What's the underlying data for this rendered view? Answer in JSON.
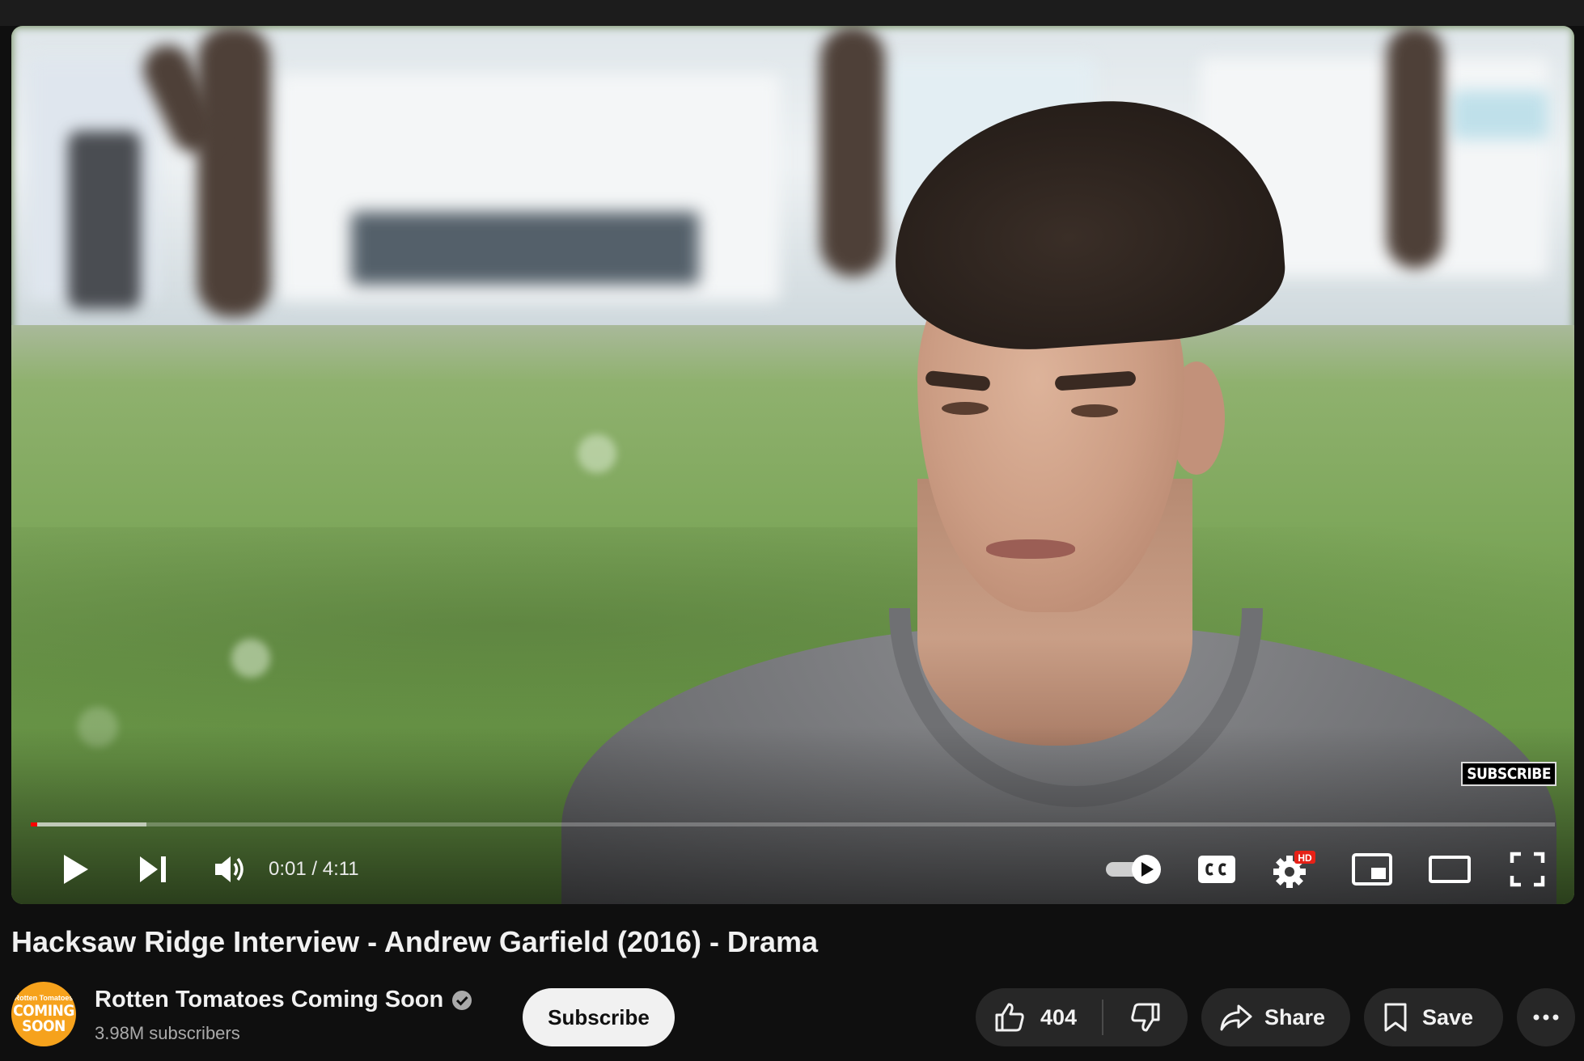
{
  "player": {
    "watermark": "SUBSCRIBE",
    "progress_fraction": 0.004,
    "buffered_fraction": 0.076,
    "time_display": "0:01 / 4:11",
    "quality_badge": "HD",
    "autoplay_on": true,
    "controls": {
      "play": "play-icon",
      "next": "next-icon",
      "volume": "volume-icon",
      "autoplay": "autoplay-toggle",
      "captions": "captions-icon",
      "settings": "settings-icon",
      "miniplayer": "miniplayer-icon",
      "theater": "theater-icon",
      "fullscreen": "fullscreen-icon"
    }
  },
  "video": {
    "title": "Hacksaw Ridge Interview - Andrew Garfield (2016) - Drama"
  },
  "channel": {
    "avatar_small": "Rotten Tomatoes",
    "avatar_text_1": "COMING",
    "avatar_text_2": "SOON",
    "name": "Rotten Tomatoes Coming Soon",
    "verified": true,
    "subscribers": "3.98M subscribers",
    "subscribe_label": "Subscribe"
  },
  "actions": {
    "like_count": "404",
    "share_label": "Share",
    "save_label": "Save"
  },
  "colors": {
    "accent": "#ff0000",
    "background": "#0f0f0f",
    "pill": "#272727",
    "avatar": "#f6a21c"
  }
}
